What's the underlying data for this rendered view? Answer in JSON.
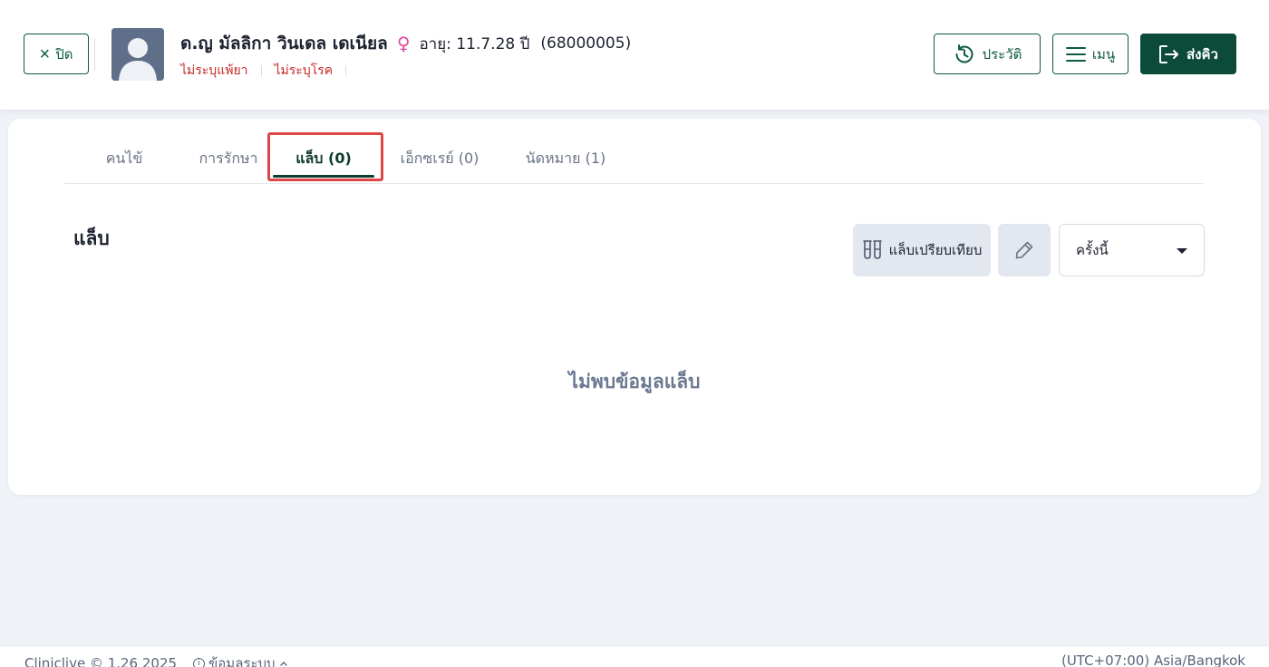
{
  "header": {
    "close_label": "ปิด",
    "patient": {
      "name": "ด.ญ มัลลิกา วินเดล เดเนียล",
      "sex_symbol": "♀",
      "age": "อายุ: 11.7.28 ปี",
      "hn": "(68000005)",
      "allergy": "ไม่ระบุแพ้ยา",
      "disease": "ไม่ระบุโรค"
    },
    "history_label": "ประวัติ",
    "menu_label": "เมนู",
    "send_label": "ส่งคิว"
  },
  "tabs": [
    {
      "label": "คนไข้",
      "active": false
    },
    {
      "label": "การรักษา",
      "active": false
    },
    {
      "label": "แล็บ (0)",
      "active": true
    },
    {
      "label": "เอ็กซเรย์ (0)",
      "active": false
    },
    {
      "label": "นัดหมาย (1)",
      "active": false
    }
  ],
  "lab": {
    "title": "แล็บ",
    "compare_label": "แล็บเปรียบเทียบ",
    "visit_select_value": "ครั้งนี้",
    "empty_message": "ไม่พบข้อมูลแล็บ"
  },
  "footer": {
    "version": "Cliniclive © 1.26 2025",
    "system_info": "ข้อมูลระบบ",
    "timezone": "(UTC+07:00) Asia/Bangkok"
  },
  "colors": {
    "primary": "#0c4a3a",
    "alert": "#c62828",
    "highlight": "#e04545",
    "background": "#eff2f7"
  },
  "icons": {
    "close": "close-icon",
    "history": "history-icon",
    "menu": "hamburger-icon",
    "send": "send-queue-icon",
    "compare": "test-tubes-icon",
    "pen": "pen-icon",
    "dropdown": "caret-down-icon",
    "info": "info-icon",
    "expand": "chevron-up-icon"
  }
}
